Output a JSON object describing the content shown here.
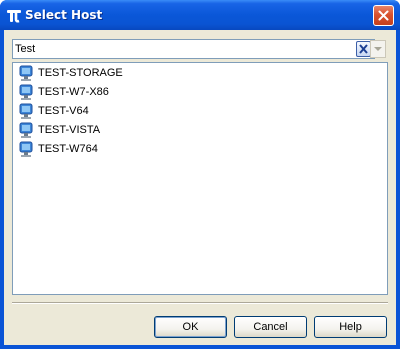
{
  "window": {
    "title": "Select Host",
    "icon": "pi-app-icon",
    "close_icon": "close-icon"
  },
  "search": {
    "value": "Test",
    "clear_icon": "clear-icon",
    "dropdown_icon": "chevron-down-icon"
  },
  "hosts": [
    {
      "label": "TEST-STORAGE",
      "icon": "computer-icon"
    },
    {
      "label": "TEST-W7-X86",
      "icon": "computer-icon"
    },
    {
      "label": "TEST-V64",
      "icon": "computer-icon"
    },
    {
      "label": "TEST-VISTA",
      "icon": "computer-icon"
    },
    {
      "label": "TEST-W764",
      "icon": "computer-icon"
    }
  ],
  "buttons": {
    "ok": "OK",
    "cancel": "Cancel",
    "help": "Help"
  },
  "colors": {
    "titlebar": "#0a54d6",
    "dialog_bg": "#ece9d8",
    "border": "#7f9db9"
  }
}
